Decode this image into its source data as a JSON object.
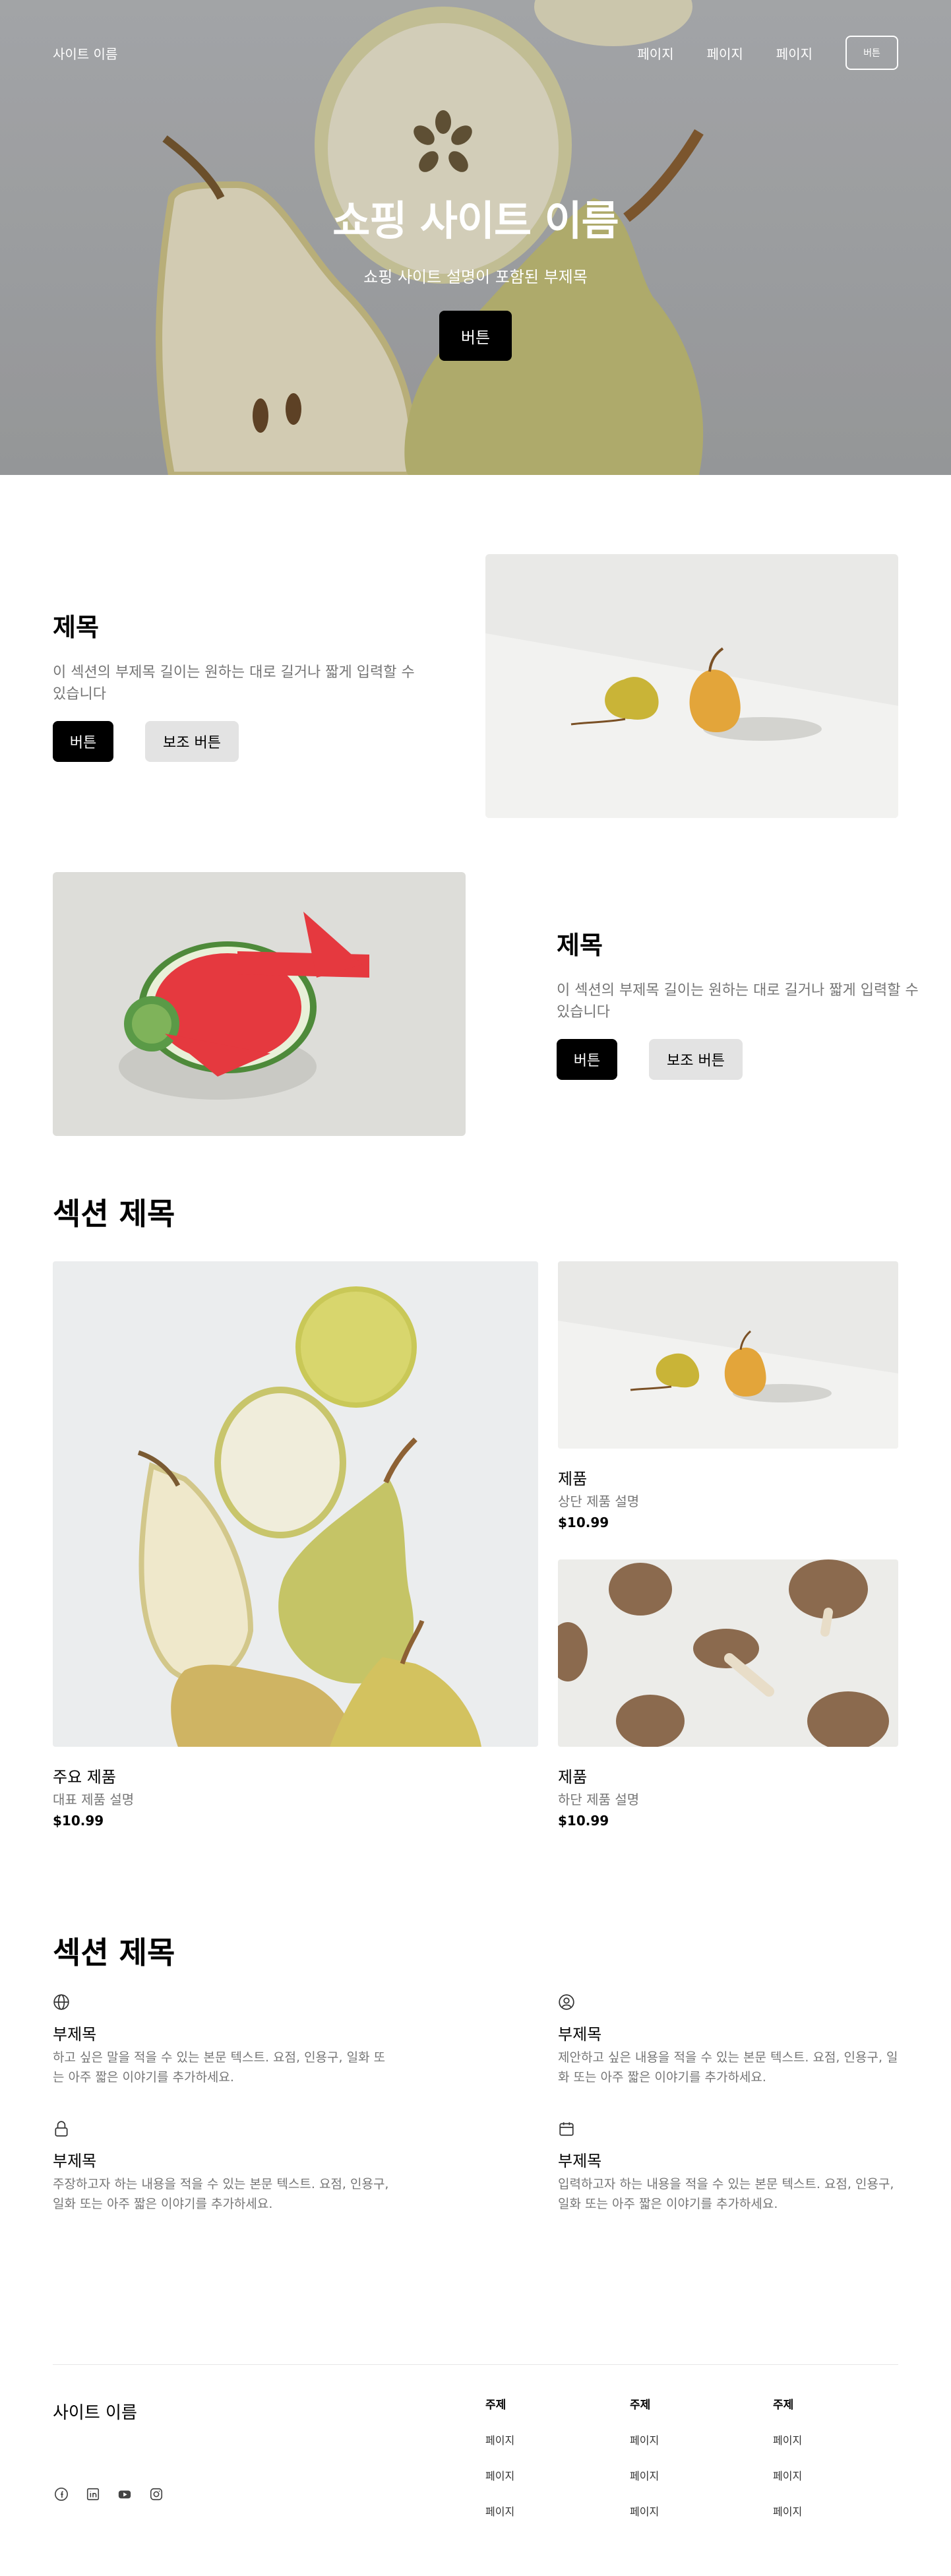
{
  "hero": {
    "brand": "사이트 이름",
    "nav": [
      "페이지",
      "페이지",
      "페이지"
    ],
    "nav_button": "버튼",
    "title": "쇼핑 사이트 이름",
    "subtitle": "쇼핑 사이트 설명이 포함된 부제목",
    "button": "버튼"
  },
  "features_rows": [
    {
      "title": "제목",
      "desc": "이 섹션의 부제목 길이는 원하는 대로 길거나 짧게 입력할 수 있습니다",
      "primary": "버튼",
      "secondary": "보조 버튼"
    },
    {
      "title": "제목",
      "desc": "이 섹션의 부제목 길이는 원하는 대로 길거나 짧게 입력할 수 있습니다",
      "primary": "버튼",
      "secondary": "보조 버튼"
    }
  ],
  "products": {
    "title": "섹션 제목",
    "items": [
      {
        "name": "주요 제품",
        "desc": "대표 제품 설명",
        "price": "$10.99"
      },
      {
        "name": "제품",
        "desc": "상단 제품 설명",
        "price": "$10.99"
      },
      {
        "name": "제품",
        "desc": "하단 제품 설명",
        "price": "$10.99"
      }
    ]
  },
  "features": {
    "title": "섹션 제목",
    "items": [
      {
        "icon": "globe-icon",
        "title": "부제목",
        "body": "하고 싶은 말을 적을 수 있는 본문 텍스트. 요점, 인용구, 일화 또는 아주 짧은 이야기를 추가하세요."
      },
      {
        "icon": "user-circle-icon",
        "title": "부제목",
        "body": "제안하고 싶은 내용을 적을 수 있는 본문 텍스트. 요점, 인용구, 일화 또는 아주 짧은 이야기를 추가하세요."
      },
      {
        "icon": "lock-icon",
        "title": "부제목",
        "body": "주장하고자 하는 내용을 적을 수 있는 본문 텍스트. 요점, 인용구, 일화 또는 아주 짧은 이야기를 추가하세요."
      },
      {
        "icon": "calendar-icon",
        "title": "부제목",
        "body": "입력하고자 하는 내용을 적을 수 있는 본문 텍스트. 요점, 인용구, 일화 또는 아주 짧은 이야기를 추가하세요."
      }
    ]
  },
  "footer": {
    "brand": "사이트 이름",
    "socials": [
      "facebook-icon",
      "linkedin-icon",
      "youtube-icon",
      "instagram-icon"
    ],
    "columns": [
      {
        "heading": "주제",
        "links": [
          "페이지",
          "페이지",
          "페이지"
        ]
      },
      {
        "heading": "주제",
        "links": [
          "페이지",
          "페이지",
          "페이지"
        ]
      },
      {
        "heading": "주제",
        "links": [
          "페이지",
          "페이지",
          "페이지"
        ]
      }
    ]
  },
  "colors": {
    "primary_button": "#000000",
    "secondary_button": "#e3e3e3",
    "muted_text": "#757575"
  }
}
